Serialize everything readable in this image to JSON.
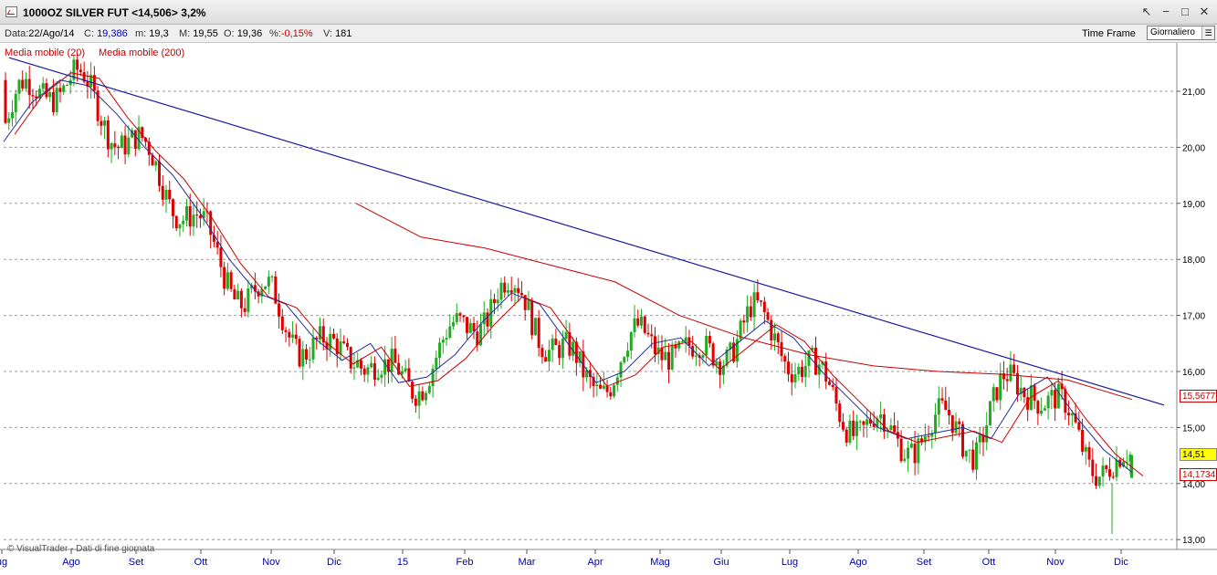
{
  "window": {
    "title": "1000OZ SILVER FUT <14,506> 3,2%",
    "buttons": [
      "↖",
      "−",
      "□",
      "✕"
    ]
  },
  "info": {
    "data_label": "Data:",
    "data_value": "22/Ago/14",
    "close_label": "C:",
    "close_value": "19,386",
    "min_label": "m:",
    "min_value": "19,3",
    "max_label": "M:",
    "max_value": "19,55",
    "open_label": "O:",
    "open_value": "19,36",
    "pct_label": "%:",
    "pct_value": "-0,15%",
    "vol_label": "V:",
    "vol_value": "181",
    "timeframe_label": "Time Frame",
    "timeframe_value": "Giornaliero"
  },
  "legend": {
    "ma20": "Media mobile (20)",
    "ma200": "Media mobile (200)"
  },
  "footer": "© VisualTrader - Dati di fine giornata",
  "price_tags": {
    "ma200_value": "15,5677",
    "last_price": "14,51",
    "ma20_value": "14,1734"
  },
  "colors": {
    "up": "#22aa22",
    "down": "#dd0000",
    "ma20": "#1f2fa0",
    "ma200": "#cc0000",
    "trendline": "#1a1aa0",
    "last_tag_bg": "#ffff00"
  },
  "chart_data": {
    "type": "line",
    "title": "",
    "y_ticks": [
      "21,00",
      "20,00",
      "19,00",
      "18,00",
      "17,00",
      "16,00",
      "15,00",
      "14,00",
      "13,00"
    ],
    "ylim": [
      13.0,
      21.0
    ],
    "x_ticks": [
      "ug",
      "Ago",
      "Set",
      "Ott",
      "Nov",
      "Dic",
      "15",
      "Feb",
      "Mar",
      "Apr",
      "Mag",
      "Giu",
      "Lug",
      "Ago",
      "Set",
      "Ott",
      "Nov",
      "Dic"
    ],
    "grid": true,
    "series": [
      {
        "name": "Media mobile (20)",
        "values": [
          20.1,
          20.8,
          21.2,
          21.1,
          20.6,
          20.0,
          19.5,
          18.8,
          18.0,
          17.4,
          17.2,
          16.6,
          16.2,
          16.5,
          15.8,
          15.9,
          16.3,
          16.9,
          17.4,
          17.2,
          16.5,
          15.8,
          16.0,
          16.5,
          16.6,
          16.1,
          16.5,
          16.9,
          16.6,
          16.0,
          15.5,
          15.0,
          14.8,
          14.9,
          15.0,
          14.8,
          15.6,
          15.9,
          15.2,
          14.6,
          14.2
        ]
      },
      {
        "name": "Media mobile (200)",
        "values": [
          19.0,
          18.4,
          18.2,
          17.9,
          17.6,
          17.0,
          16.6,
          16.3,
          16.1,
          16.0,
          15.95,
          15.85,
          15.5
        ]
      }
    ],
    "trendline": {
      "from": 21.6,
      "to": 15.4
    },
    "ohlc_sample": {
      "date": "22/Ago/14",
      "open": 19.36,
      "high": 19.55,
      "low": 19.3,
      "close": 19.386,
      "volume": 181
    },
    "last_price": 14.51,
    "ma20_last": 14.1734,
    "ma200_last": 15.5677
  }
}
